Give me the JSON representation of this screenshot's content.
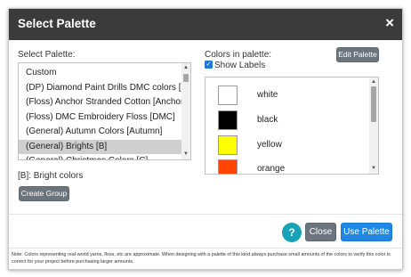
{
  "dialog": {
    "title": "Select Palette",
    "close_glyph": "×"
  },
  "left_panel": {
    "select_label": "Select Palette:",
    "palettes": [
      "Custom",
      "(DP) Diamond Paint Drills DMC colors [DP]",
      "(Floss) Anchor Stranded Cotton [Anchor]",
      "(Floss) DMC Embroidery Floss [DMC]",
      "(General) Autumn Colors [Autumn]",
      "(General) Brights [B]",
      "(General) Christmas Colors [C]"
    ],
    "selected_palette": "(General) Brights [B]",
    "description": "[B]: Bright colors",
    "create_group_label": "Create Group"
  },
  "right_panel": {
    "colors_label": "Colors in palette:",
    "edit_palette_label": "Edit Palette",
    "show_labels": {
      "label": "Show Labels",
      "checked": true
    },
    "colors": [
      {
        "name": "white",
        "hex": "#ffffff"
      },
      {
        "name": "black",
        "hex": "#000000"
      },
      {
        "name": "yellow",
        "hex": "#ffff00"
      },
      {
        "name": "orange",
        "hex": "#ff4500"
      }
    ]
  },
  "footer": {
    "help_glyph": "?",
    "close_label": "Close",
    "use_palette_label": "Use Palette"
  },
  "note": "Note: Colors representing real-world yarns, floss, etc are approximate. When designing with a palette of this kind always purchase small amounts of the colors to verify this color is correct for your project before purchasing larger amounts.",
  "colors": {
    "header_bg": "#3b3b3b",
    "primary": "#1f88e5",
    "secondary": "#6c757d",
    "help": "#17a2b8",
    "selected_item_bg": "#cfcfcf"
  }
}
